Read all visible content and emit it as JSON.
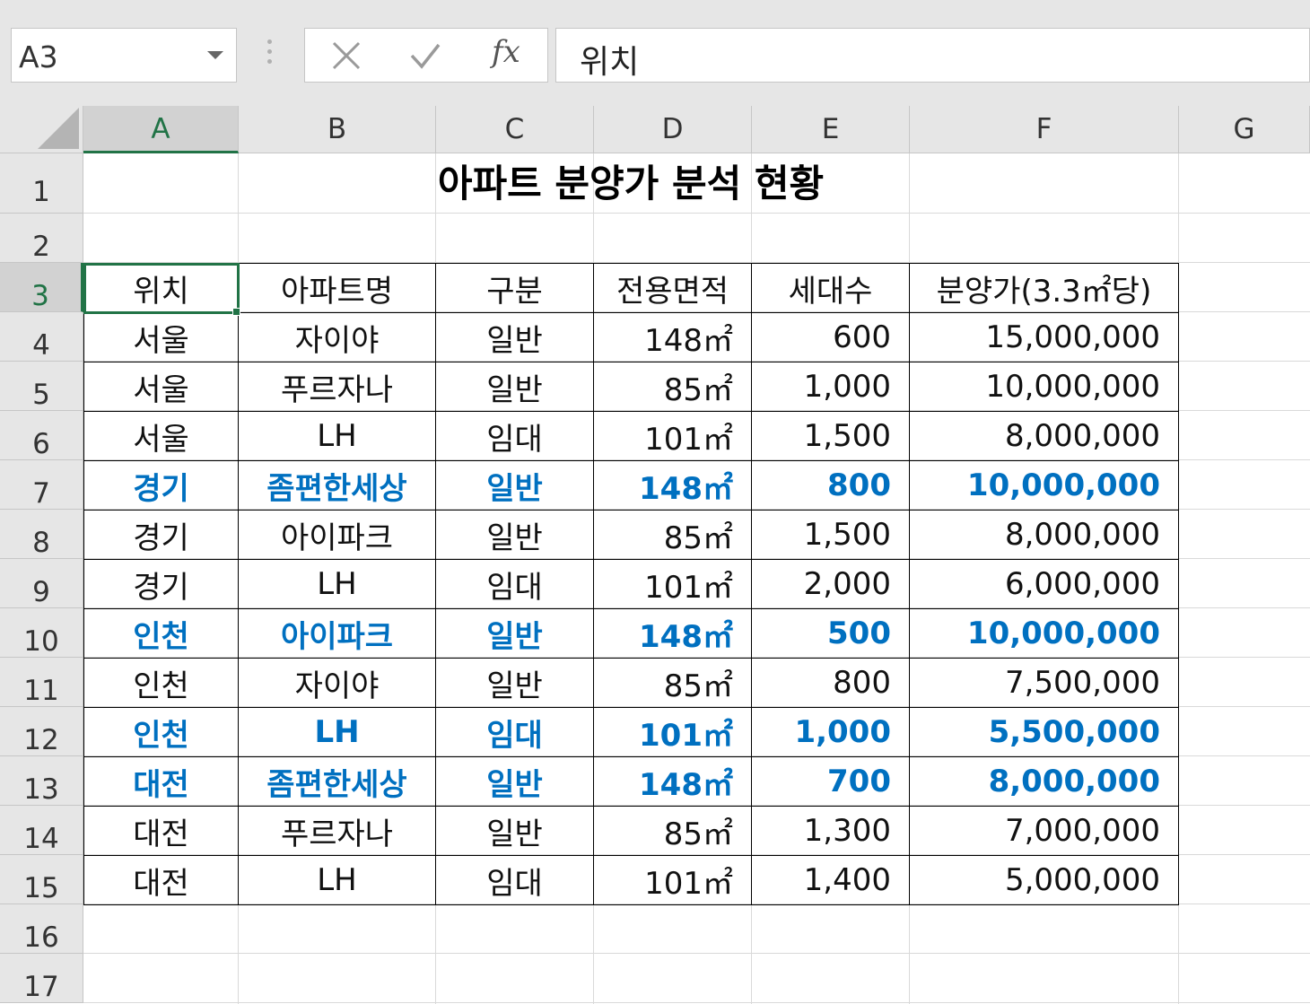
{
  "name_box": {
    "value": "A3"
  },
  "formula_bar": {
    "value": "위치",
    "fx_label": "fx"
  },
  "columns": [
    "A",
    "B",
    "C",
    "D",
    "E",
    "F",
    "G"
  ],
  "rows": [
    "1",
    "2",
    "3",
    "4",
    "5",
    "6",
    "7",
    "8",
    "9",
    "10",
    "11",
    "12",
    "13",
    "14",
    "15",
    "16",
    "17"
  ],
  "selected_cell": "A3",
  "sheet": {
    "title": "아파트 분양가 분석 현황",
    "headers": [
      "위치",
      "아파트명",
      "구분",
      "전용면적",
      "세대수",
      "분양가(3.3㎡당)"
    ],
    "rows": [
      {
        "location": "서울",
        "name": "자이야",
        "type": "일반",
        "area": "148㎡",
        "units": "600",
        "price": "15,000,000",
        "highlight": false
      },
      {
        "location": "서울",
        "name": "푸르자나",
        "type": "일반",
        "area": "85㎡",
        "units": "1,000",
        "price": "10,000,000",
        "highlight": false
      },
      {
        "location": "서울",
        "name": "LH",
        "type": "임대",
        "area": "101㎡",
        "units": "1,500",
        "price": "8,000,000",
        "highlight": false
      },
      {
        "location": "경기",
        "name": "좀편한세상",
        "type": "일반",
        "area": "148㎡",
        "units": "800",
        "price": "10,000,000",
        "highlight": true
      },
      {
        "location": "경기",
        "name": "아이파크",
        "type": "일반",
        "area": "85㎡",
        "units": "1,500",
        "price": "8,000,000",
        "highlight": false
      },
      {
        "location": "경기",
        "name": "LH",
        "type": "임대",
        "area": "101㎡",
        "units": "2,000",
        "price": "6,000,000",
        "highlight": false
      },
      {
        "location": "인천",
        "name": "아이파크",
        "type": "일반",
        "area": "148㎡",
        "units": "500",
        "price": "10,000,000",
        "highlight": true
      },
      {
        "location": "인천",
        "name": "자이야",
        "type": "일반",
        "area": "85㎡",
        "units": "800",
        "price": "7,500,000",
        "highlight": false
      },
      {
        "location": "인천",
        "name": "LH",
        "type": "임대",
        "area": "101㎡",
        "units": "1,000",
        "price": "5,500,000",
        "highlight": true
      },
      {
        "location": "대전",
        "name": "좀편한세상",
        "type": "일반",
        "area": "148㎡",
        "units": "700",
        "price": "8,000,000",
        "highlight": true
      },
      {
        "location": "대전",
        "name": "푸르자나",
        "type": "일반",
        "area": "85㎡",
        "units": "1,300",
        "price": "7,000,000",
        "highlight": false
      },
      {
        "location": "대전",
        "name": "LH",
        "type": "임대",
        "area": "101㎡",
        "units": "1,400",
        "price": "5,000,000",
        "highlight": false
      }
    ]
  },
  "colors": {
    "highlight_text": "#0070c0",
    "selection_accent": "#217346",
    "header_bg": "#e6e6e6"
  }
}
